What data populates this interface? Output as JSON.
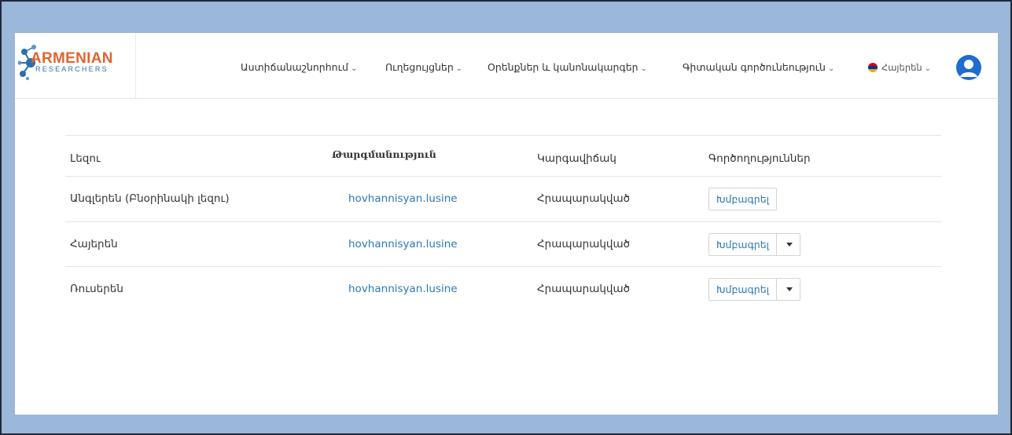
{
  "logo": {
    "title": "ARMENIAN",
    "subtitle": "RESEARCHERS"
  },
  "nav": {
    "items": [
      {
        "label": "Աստիճանաշնորհում"
      },
      {
        "label": "Ուղեցույցներ"
      },
      {
        "label": "Օրենքներ և կանոնակարգեր"
      },
      {
        "label": "Գիտական գործունեություն"
      }
    ],
    "language": "Հայերեն"
  },
  "colors": {
    "logo_orange": "#e2632e",
    "logo_blue": "#2b6fae",
    "link_blue": "#2a7ab9",
    "avatar_blue": "#1f6bd0",
    "flag": [
      "#d90012",
      "#0033a0",
      "#f2a800"
    ]
  },
  "table": {
    "headers": {
      "language": "Լեզու",
      "translation": "Թարգմանություն",
      "status": "Կարգավիճակ",
      "actions": "Գործողություններ"
    },
    "rows": [
      {
        "language": "Անգլերեն (Բնօրինակի լեզու)",
        "translator": "hovhannisyan.lusine",
        "status": "Հրապարակված",
        "action": "Խմբագրել",
        "has_dropdown": false
      },
      {
        "language": "Հայերեն",
        "translator": "hovhannisyan.lusine",
        "status": "Հրապարակված",
        "action": "Խմբագրել",
        "has_dropdown": true
      },
      {
        "language": "Ռուսերեն",
        "translator": "hovhannisyan.lusine",
        "status": "Հրապարակված",
        "action": "Խմբագրել",
        "has_dropdown": true
      }
    ]
  }
}
